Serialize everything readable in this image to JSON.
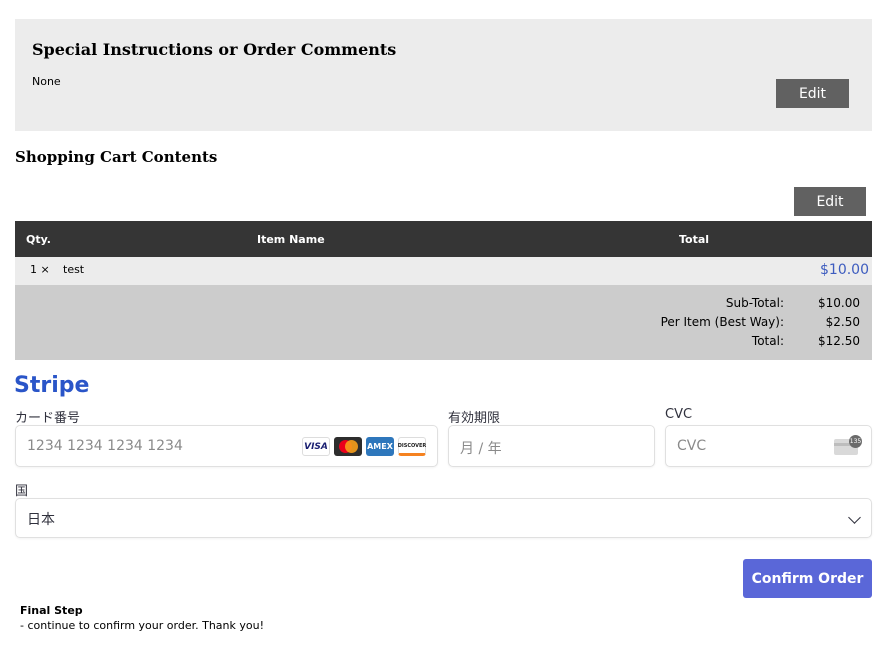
{
  "comments": {
    "title": "Special Instructions or Order Comments",
    "value": "None",
    "edit_label": "Edit"
  },
  "cart": {
    "title": "Shopping Cart Contents",
    "edit_label": "Edit",
    "headers": {
      "qty": "Qty.",
      "name": "Item Name",
      "total": "Total"
    },
    "items": [
      {
        "qty": "1 ×",
        "name": "test",
        "total": "$10.00"
      }
    ],
    "totals": [
      {
        "label": "Sub-Total:",
        "value": "$10.00"
      },
      {
        "label": "Per Item (Best Way):",
        "value": "$2.50"
      },
      {
        "label": "Total:",
        "value": "$12.50"
      }
    ]
  },
  "stripe": {
    "title": "Stripe",
    "card_number_label": "カード番号",
    "card_number_placeholder": "1234 1234 1234 1234",
    "brands": [
      "VISA",
      "mastercard",
      "AMEX",
      "DISCOVER"
    ],
    "expiry_label": "有効期限",
    "expiry_placeholder": "月 / 年",
    "cvc_label": "CVC",
    "cvc_placeholder": "CVC",
    "cvc_badge": "135",
    "country_label": "国",
    "country_value": "日本"
  },
  "confirm_label": "Confirm Order",
  "final": {
    "title": "Final Step",
    "text": "- continue to confirm your order. Thank you!"
  },
  "colors": {
    "accent_blue": "#2a55c8",
    "button_purple": "#5a67d8",
    "price_blue": "#3d5cbf",
    "header_dark": "#353535"
  }
}
